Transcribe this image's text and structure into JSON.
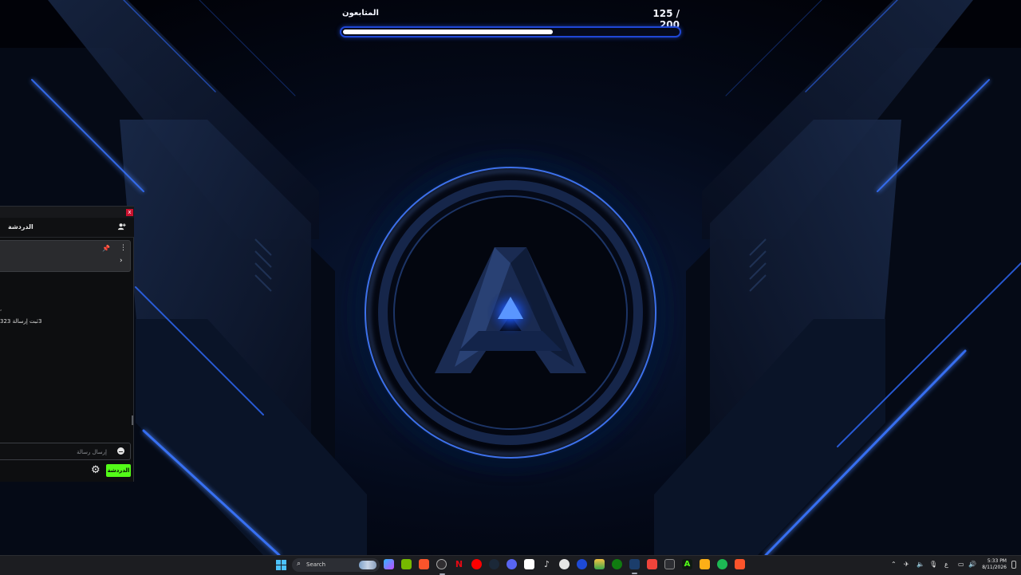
{
  "goal": {
    "label": "المتابعون",
    "current": 125,
    "target": 200,
    "count_text": "125 / 200",
    "progress_fraction": 0.625,
    "accent": "#1f47d6"
  },
  "chat": {
    "title": "الدردشة",
    "close_label": "x",
    "pinned_icon": "pin-icon",
    "messages": [
      {
        "text": ","
      },
      {
        "text": "3ثبت إرسالة 323"
      }
    ],
    "input_placeholder": "إرسال رسالة",
    "send_label": "الدردشة",
    "send_color": "#53fc18"
  },
  "taskbar": {
    "search_label": "Search",
    "apps": [
      "start-icon",
      "copilot-icon",
      "nvidia-icon",
      "brave-icon",
      "obs-icon",
      "netflix-icon",
      "youtube-icon",
      "steam-icon",
      "discord-icon",
      "calendar-icon",
      "music-icon",
      "github-icon",
      "ea-icon",
      "files-icon",
      "xbox-icon",
      "steam-alt-icon",
      "anydesk-icon",
      "eset-icon",
      "logo-a-icon",
      "rockstar-icon",
      "spotify-icon",
      "brave-alt-icon"
    ],
    "tray": {
      "lang": "ع",
      "time": "5:33 PM",
      "date": "8/11/2026"
    }
  }
}
